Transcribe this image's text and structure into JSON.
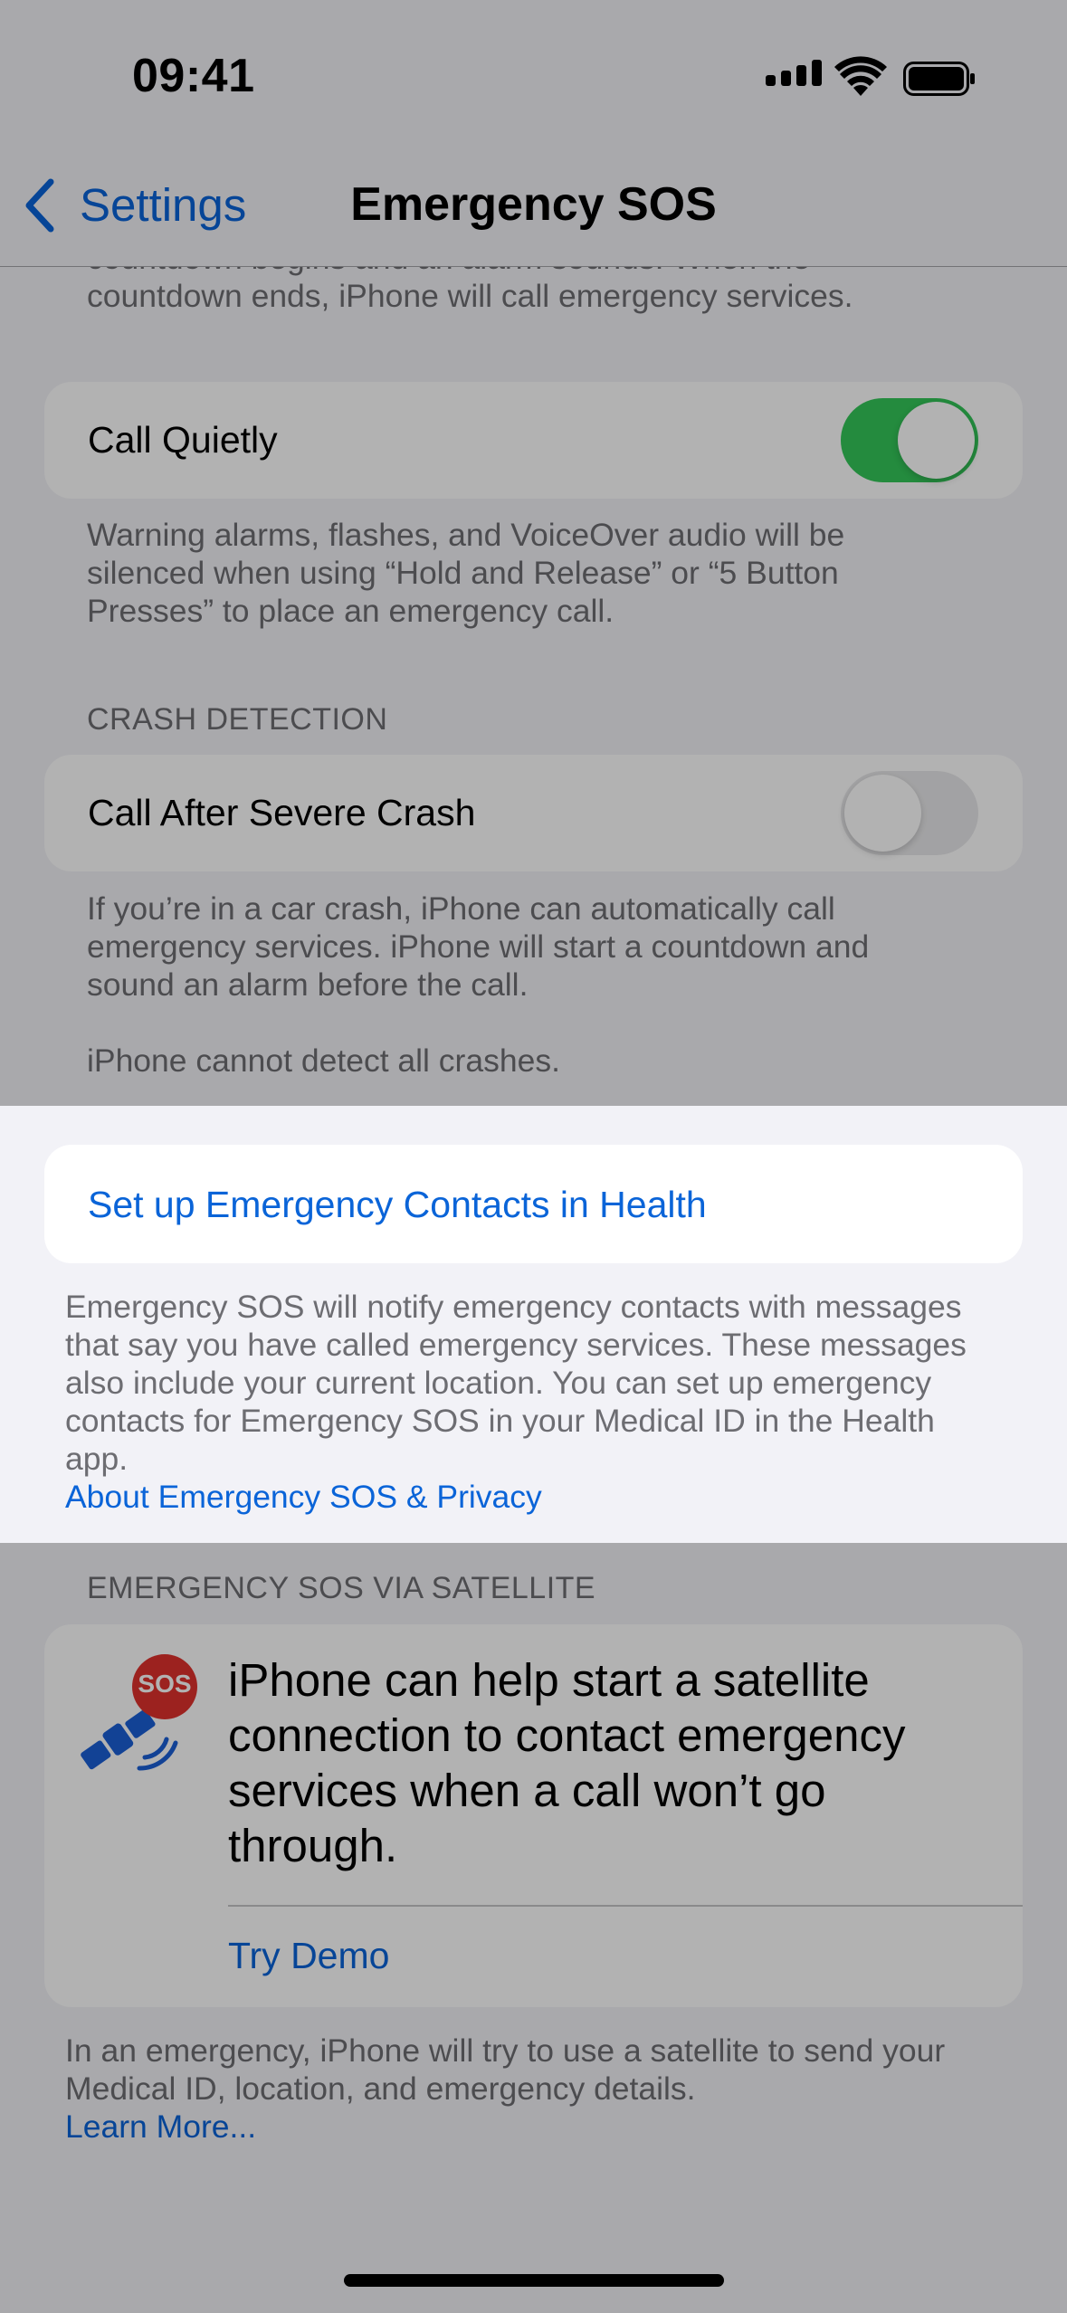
{
  "status_bar": {
    "time": "09:41"
  },
  "nav": {
    "back_label": "Settings",
    "title": "Emergency SOS"
  },
  "countdown_footer": "countdown begins and an alarm sounds. When the countdown ends, iPhone will call emergency services.",
  "call_quietly": {
    "label": "Call Quietly",
    "on": true,
    "footer": "Warning alarms, flashes, and VoiceOver audio will be silenced when using “Hold and Release” or “5 Button Presses” to place an emergency call."
  },
  "crash_detection": {
    "header": "CRASH DETECTION",
    "label": "Call After Severe Crash",
    "on": false,
    "footer_1": "If you’re in a car crash, iPhone can automatically call emergency services. iPhone will start a countdown and sound an alarm before the call.",
    "footer_2": "iPhone cannot detect all crashes."
  },
  "emergency_contacts": {
    "link": "Set up Emergency Contacts in Health",
    "footer": "Emergency SOS will notify emergency contacts with messages that say you have called emergency services. These messages also include your current location. You can set up emergency contacts for Emergency SOS in your Medical ID in the Health app.",
    "privacy_link": "About Emergency SOS & Privacy"
  },
  "satellite": {
    "header": "EMERGENCY SOS VIA SATELLITE",
    "badge": "SOS",
    "description": "iPhone can help start a satellite connection to contact emergency services when a call won’t go through.",
    "demo_link": "Try Demo",
    "footer": "In an emergency, iPhone will try to use a satellite to send your Medical ID, location, and emergency details.",
    "learn_more": "Learn More..."
  },
  "colors": {
    "accent": "#0a64d8",
    "toggle_on": "#34c759",
    "toggle_off": "#e9e9eb",
    "sos_badge": "#e0322d",
    "satellite_icon": "#1b5fd6",
    "dim_overlay": "rgba(0,0,0,0.30)"
  }
}
